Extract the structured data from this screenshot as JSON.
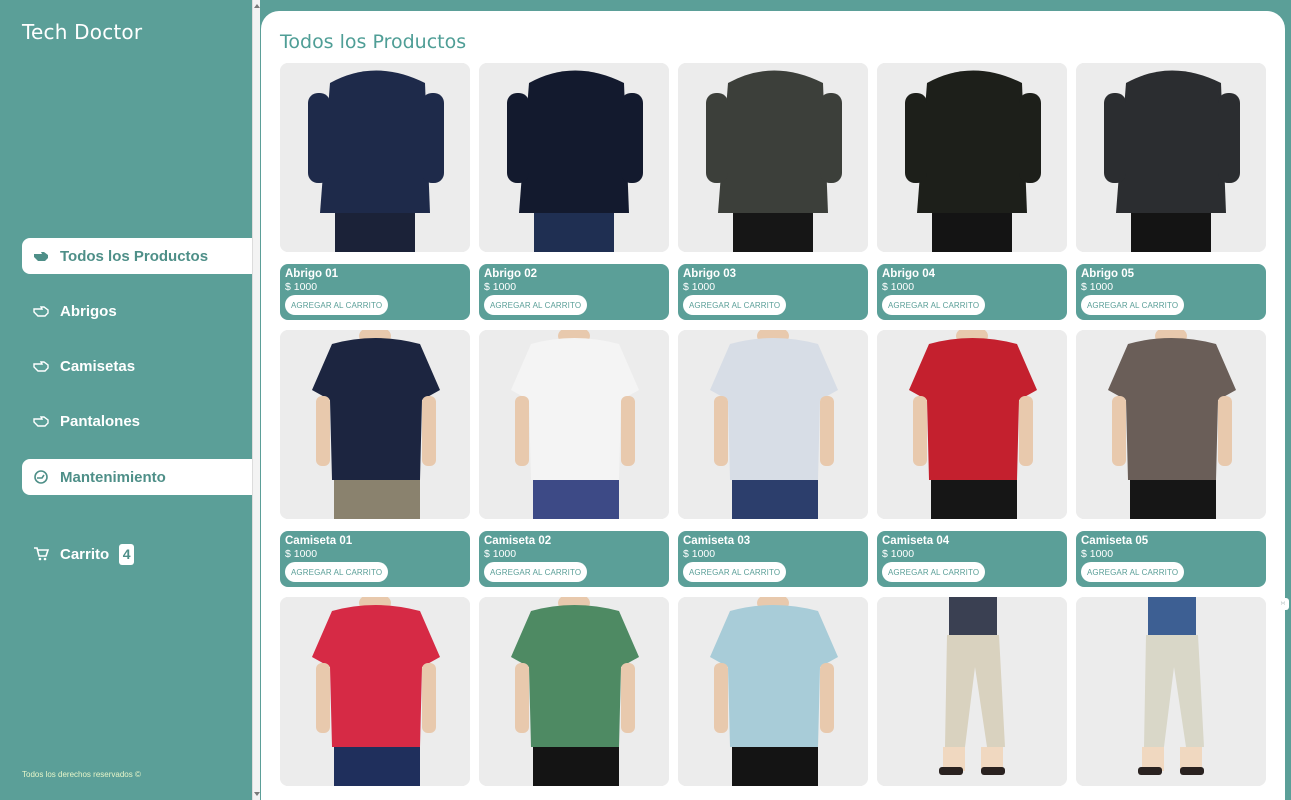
{
  "brand": "Tech Doctor",
  "nav": [
    {
      "label": "Todos los Productos",
      "icon": "pointing-hand-icon",
      "active": true
    },
    {
      "label": "Abrigos",
      "icon": "pointing-hand-outline-icon",
      "active": false
    },
    {
      "label": "Camisetas",
      "icon": "pointing-hand-outline-icon",
      "active": false
    },
    {
      "label": "Pantalones",
      "icon": "pointing-hand-outline-icon",
      "active": false
    },
    {
      "label": "Mantenimiento",
      "icon": "gear-hand-icon",
      "active": true
    }
  ],
  "cart": {
    "label": "Carrito",
    "count": "4",
    "icon": "cart-icon"
  },
  "copyright": "Todos los derechos reservados ©",
  "page_title": "Todos los Productos",
  "add_label": "AGREGAR AL CARRITO",
  "colors": {
    "accent": "#5b9f98",
    "title": "#4f9e96"
  },
  "products": [
    {
      "name": "Abrigo 01",
      "price": "$ 1000",
      "garment": "#1e2a4a",
      "pants": "#1b2238",
      "kind": "jacket"
    },
    {
      "name": "Abrigo 02",
      "price": "$ 1000",
      "garment": "#131a2e",
      "pants": "#1f2f52",
      "kind": "jacket"
    },
    {
      "name": "Abrigo 03",
      "price": "$ 1000",
      "garment": "#3c3f3a",
      "pants": "#161616",
      "kind": "jacket"
    },
    {
      "name": "Abrigo 04",
      "price": "$ 1000",
      "garment": "#1d1f1a",
      "pants": "#141414",
      "kind": "jacket"
    },
    {
      "name": "Abrigo 05",
      "price": "$ 1000",
      "garment": "#2b2d30",
      "pants": "#141414",
      "kind": "jacket"
    },
    {
      "name": "Camiseta 01",
      "price": "$ 1000",
      "garment": "#1c2540",
      "pants": "#8a826e",
      "kind": "tee"
    },
    {
      "name": "Camiseta 02",
      "price": "$ 1000",
      "garment": "#f4f4f4",
      "pants": "#3d4a86",
      "kind": "tee"
    },
    {
      "name": "Camiseta 03",
      "price": "$ 1000",
      "garment": "#d7dde6",
      "pants": "#2c3e6c",
      "kind": "tee"
    },
    {
      "name": "Camiseta 04",
      "price": "$ 1000",
      "garment": "#c4202e",
      "pants": "#161616",
      "kind": "tee"
    },
    {
      "name": "Camiseta 05",
      "price": "$ 1000",
      "garment": "#6a5e58",
      "pants": "#161616",
      "kind": "tee"
    },
    {
      "name": "",
      "price": "",
      "garment": "#d62a45",
      "pants": "#1f2f5c",
      "kind": "tee"
    },
    {
      "name": "",
      "price": "",
      "garment": "#4e8a63",
      "pants": "#141414",
      "kind": "tee"
    },
    {
      "name": "",
      "price": "",
      "garment": "#a8ccd8",
      "pants": "#141414",
      "kind": "tee"
    },
    {
      "name": "",
      "price": "",
      "garment": "#3a4052",
      "pants": "#d9d2bf",
      "kind": "pants"
    },
    {
      "name": "",
      "price": "",
      "garment": "#3d5f93",
      "pants": "#d9d7c8",
      "kind": "pants"
    }
  ]
}
